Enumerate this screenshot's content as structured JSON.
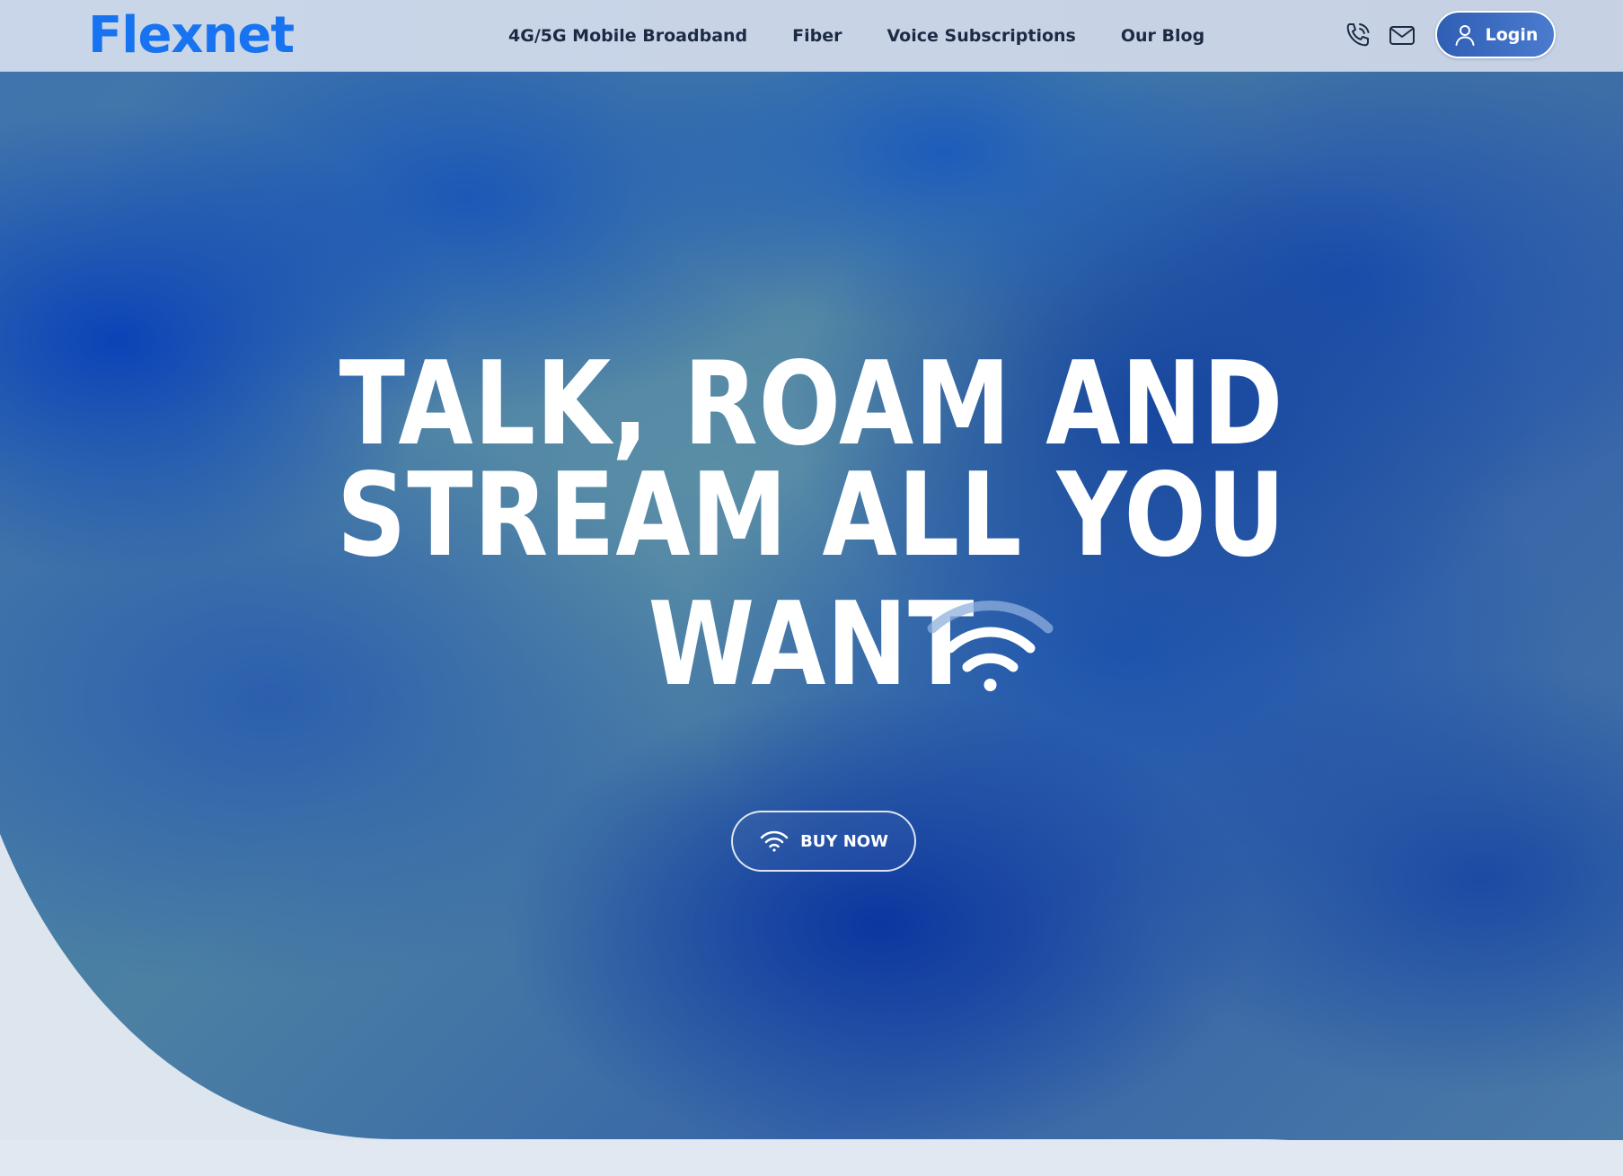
{
  "brand": {
    "logo_text": "Flexnet",
    "logo_color": "#1873f0"
  },
  "nav": {
    "items": [
      {
        "label": "4G/5G Mobile Broadband"
      },
      {
        "label": "Fiber"
      },
      {
        "label": "Voice Subscriptions"
      },
      {
        "label": "Our Blog"
      }
    ]
  },
  "header_actions": {
    "phone_icon": "phone-icon",
    "mail_icon": "mail-icon",
    "login_label": "Login",
    "login_icon": "user-icon"
  },
  "hero": {
    "headline_line1": "TALK, ROAM AND",
    "headline_line2": "STREAM ALL YOU",
    "headline_line3": "WANT",
    "headline_icon": "wifi-icon",
    "cta_label": "BUY NOW",
    "cta_icon": "wifi-icon"
  },
  "colors": {
    "accent": "#1873f0",
    "hero_blue": "#2c5fae",
    "login_gradient_start": "#2f5fb4",
    "login_gradient_end": "#4a7bcf",
    "text_dark": "#1c2a44"
  }
}
